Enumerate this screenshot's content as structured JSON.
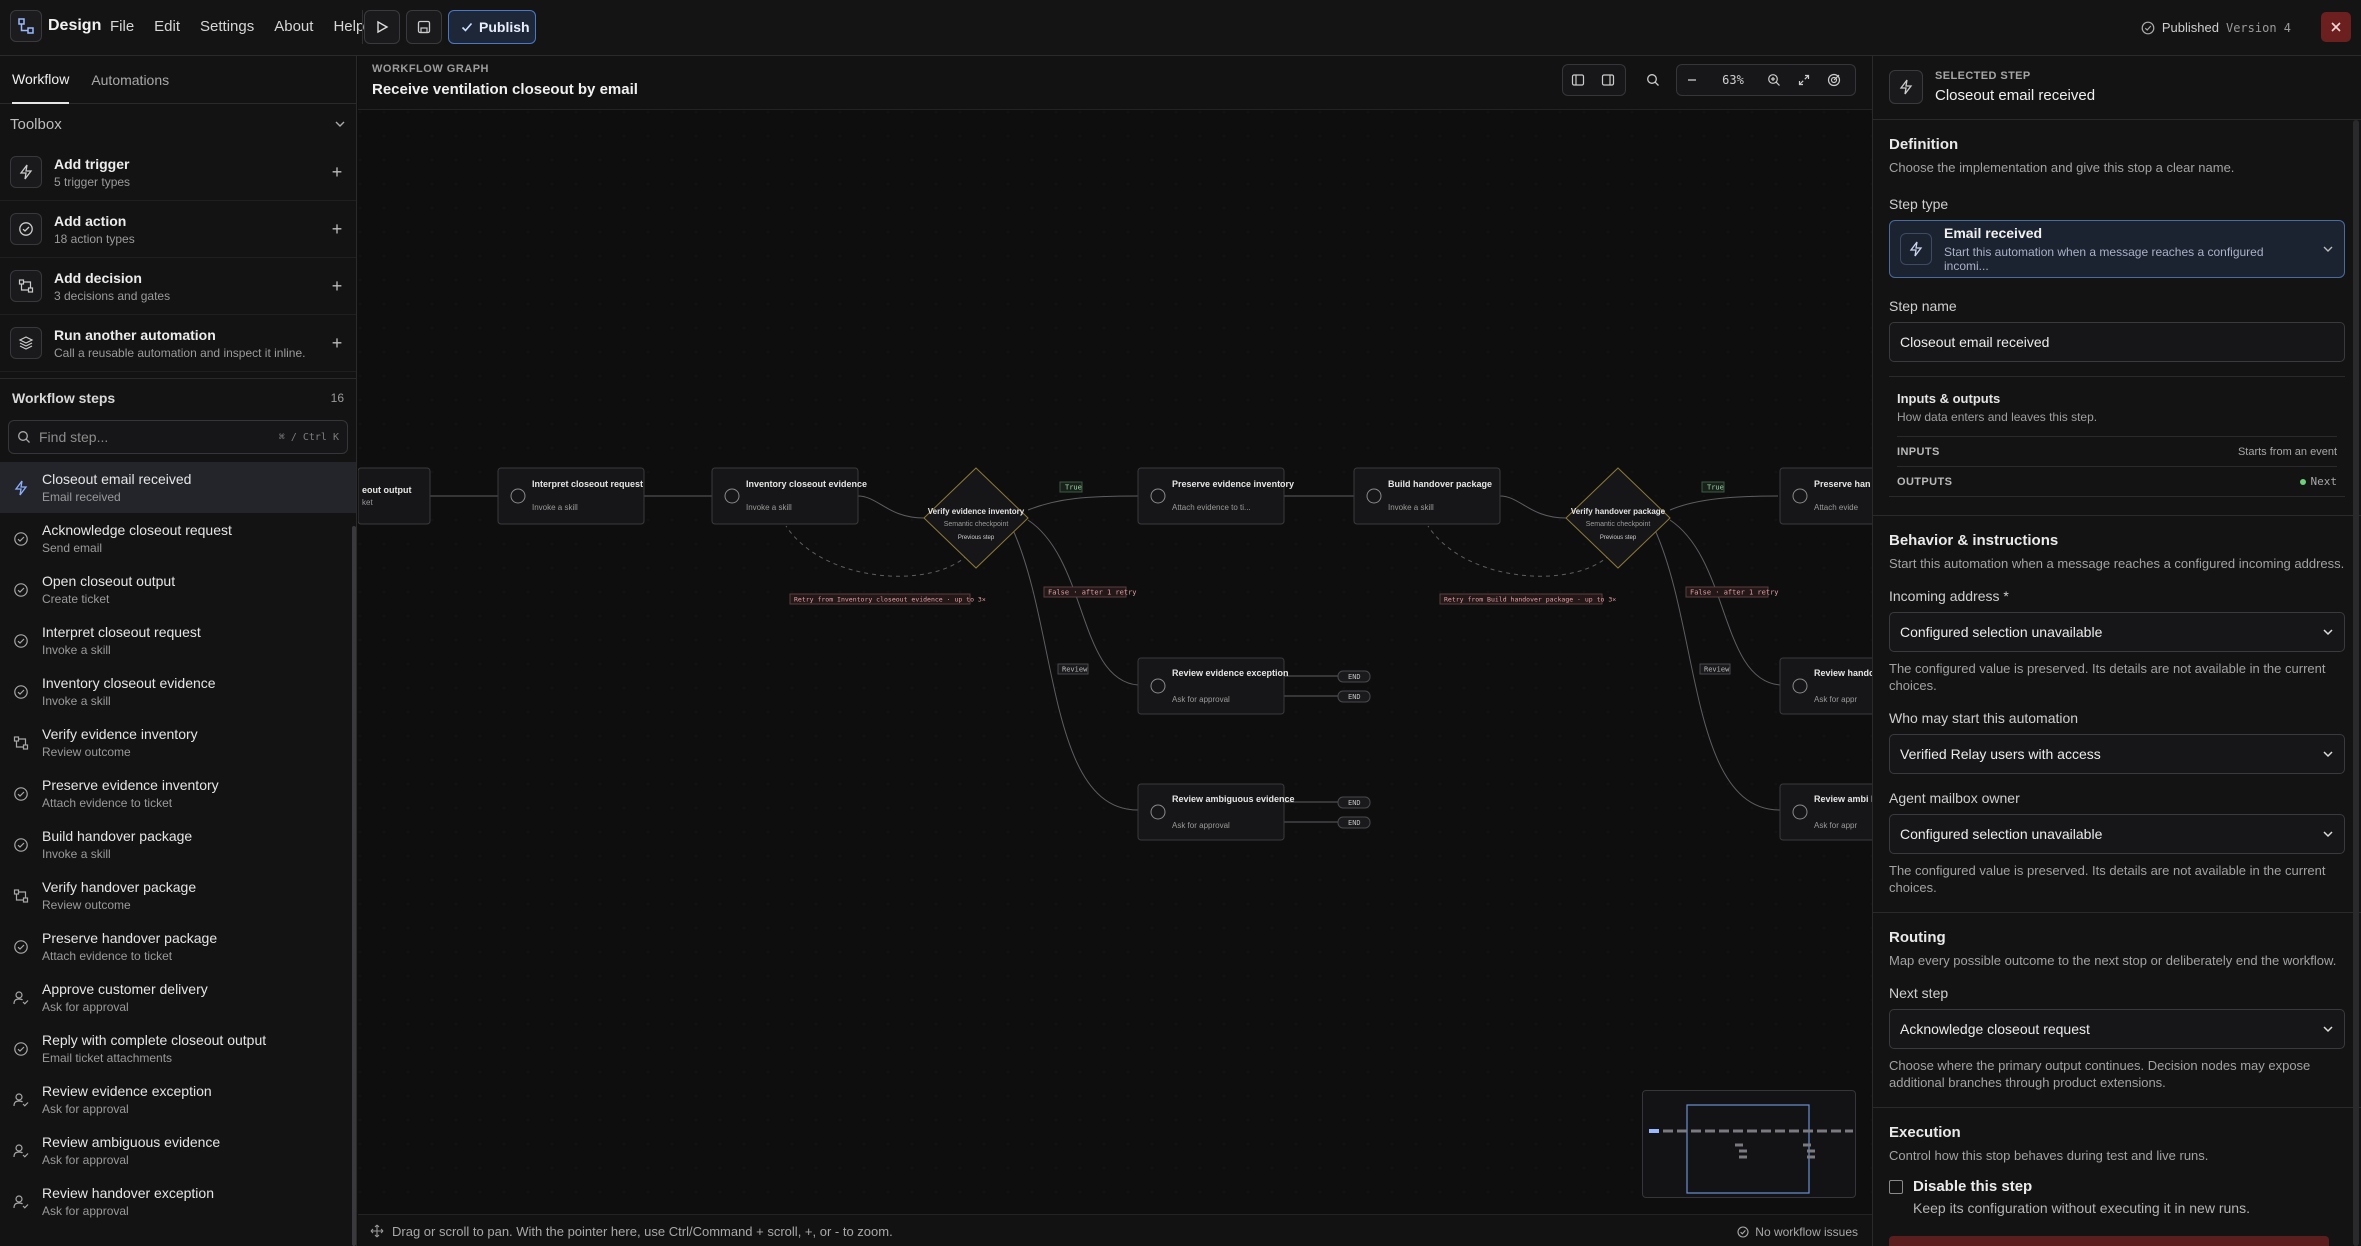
{
  "app": {
    "name": "Design",
    "menu": [
      "File",
      "Edit",
      "Settings",
      "About",
      "Help"
    ],
    "publish_label": "Publish",
    "status": "Published",
    "version": "Version 4"
  },
  "left": {
    "tabs": [
      "Workflow",
      "Automations"
    ],
    "toolbox_title": "Toolbox",
    "tools": [
      {
        "title": "Add trigger",
        "sub": "5 trigger types",
        "icon": "bolt-icon"
      },
      {
        "title": "Add action",
        "sub": "18 action types",
        "icon": "check-circle-icon"
      },
      {
        "title": "Add decision",
        "sub": "3 decisions and gates",
        "icon": "branch-icon"
      },
      {
        "title": "Run another automation",
        "sub": "Call a reusable automation and inspect it inline.",
        "icon": "layers-icon"
      }
    ],
    "steps_title": "Workflow steps",
    "steps_count": "16",
    "search_placeholder": "Find step...",
    "search_shortcut": "⌘ / Ctrl K",
    "steps": [
      {
        "name": "Closeout email received",
        "kind": "Email received",
        "icon": "bolt-icon"
      },
      {
        "name": "Acknowledge closeout request",
        "kind": "Send email",
        "icon": "check-circle-icon"
      },
      {
        "name": "Open closeout output",
        "kind": "Create ticket",
        "icon": "check-circle-icon"
      },
      {
        "name": "Interpret closeout request",
        "kind": "Invoke a skill",
        "icon": "check-circle-icon"
      },
      {
        "name": "Inventory closeout evidence",
        "kind": "Invoke a skill",
        "icon": "check-circle-icon"
      },
      {
        "name": "Verify evidence inventory",
        "kind": "Review outcome",
        "icon": "branch-icon"
      },
      {
        "name": "Preserve evidence inventory",
        "kind": "Attach evidence to ticket",
        "icon": "check-circle-icon"
      },
      {
        "name": "Build handover package",
        "kind": "Invoke a skill",
        "icon": "check-circle-icon"
      },
      {
        "name": "Verify handover package",
        "kind": "Review outcome",
        "icon": "branch-icon"
      },
      {
        "name": "Preserve handover package",
        "kind": "Attach evidence to ticket",
        "icon": "check-circle-icon"
      },
      {
        "name": "Approve customer delivery",
        "kind": "Ask for approval",
        "icon": "user-check-icon"
      },
      {
        "name": "Reply with complete closeout output",
        "kind": "Email ticket attachments",
        "icon": "check-circle-icon"
      },
      {
        "name": "Review evidence exception",
        "kind": "Ask for approval",
        "icon": "user-check-icon"
      },
      {
        "name": "Review ambiguous evidence",
        "kind": "Ask for approval",
        "icon": "user-check-icon"
      },
      {
        "name": "Review handover exception",
        "kind": "Ask for approval",
        "icon": "user-check-icon"
      }
    ]
  },
  "canvas": {
    "label": "WORKFLOW GRAPH",
    "title": "Receive ventilation closeout by email",
    "zoom": "63%",
    "footer_hint": "Drag or scroll to pan. With the pointer here, use Ctrl/Command + scroll, +, or - to zoom.",
    "footer_status": "No workflow issues",
    "nodes": [
      {
        "title": "eout output",
        "sub": "ket"
      },
      {
        "title": "Interpret closeout request",
        "sub": "Invoke a skill"
      },
      {
        "title": "Inventory closeout evidence",
        "sub": "Invoke a skill"
      },
      {
        "title": "Verify evidence inventory",
        "sub": "Semantic checkpoint",
        "prev": "Previous step"
      },
      {
        "title": "Preserve evidence inventory",
        "sub": "Attach evidence to ti..."
      },
      {
        "title": "Build handover package",
        "sub": "Invoke a skill"
      },
      {
        "title": "Verify handover package",
        "sub": "Semantic checkpoint",
        "prev": "Previous step"
      },
      {
        "title": "Preserve han package",
        "sub": "Attach evide"
      },
      {
        "title": "Review evidence exception",
        "sub": "Ask for approval"
      },
      {
        "title": "Review ambiguous evidence",
        "sub": "Ask for approval"
      },
      {
        "title": "Review hando exception",
        "sub": "Ask for appr"
      },
      {
        "title": "Review ambi handover",
        "sub": "Ask for appr"
      }
    ],
    "edge_labels": {
      "true": "True",
      "false_retry": "False · after 1 retry",
      "review": "Review",
      "retry1": "Retry from Inventory closeout evidence · up to 3×",
      "retry2": "Retry from Build handover package · up to 3×",
      "end": "END"
    }
  },
  "right": {
    "head_label": "SELECTED STEP",
    "head_title": "Closeout email received",
    "definition_title": "Definition",
    "definition_desc": "Choose the implementation and give this stop a clear name.",
    "step_type_label": "Step type",
    "step_type_name": "Email received",
    "step_type_desc": "Start this automation when a message reaches a configured incomi...",
    "step_name_label": "Step name",
    "step_name_value": "Closeout email received",
    "io_title": "Inputs & outputs",
    "io_desc": "How data enters and leaves this step.",
    "inputs_key": "INPUTS",
    "inputs_val": "Starts from an event",
    "outputs_key": "OUTPUTS",
    "outputs_val": "Next",
    "behavior_title": "Behavior & instructions",
    "behavior_desc": "Start this automation when a message reaches a configured incoming address.",
    "incoming_label": "Incoming address *",
    "incoming_value": "Configured selection unavailable",
    "preserved_note": "The configured value is preserved. Its details are not available in the current choices.",
    "who_label": "Who may start this automation",
    "who_value": "Verified Relay users with access",
    "owner_label": "Agent mailbox owner",
    "owner_value": "Configured selection unavailable",
    "routing_title": "Routing",
    "routing_desc": "Map every possible outcome to the next stop or deliberately end the workflow.",
    "next_label": "Next step",
    "next_value": "Acknowledge closeout request",
    "next_note": "Choose where the primary output continues. Decision nodes may expose additional branches through product extensions.",
    "exec_title": "Execution",
    "exec_desc": "Control how this stop behaves during test and live runs.",
    "disable_label": "Disable this step",
    "disable_desc": "Keep its configuration without executing it in new runs."
  }
}
